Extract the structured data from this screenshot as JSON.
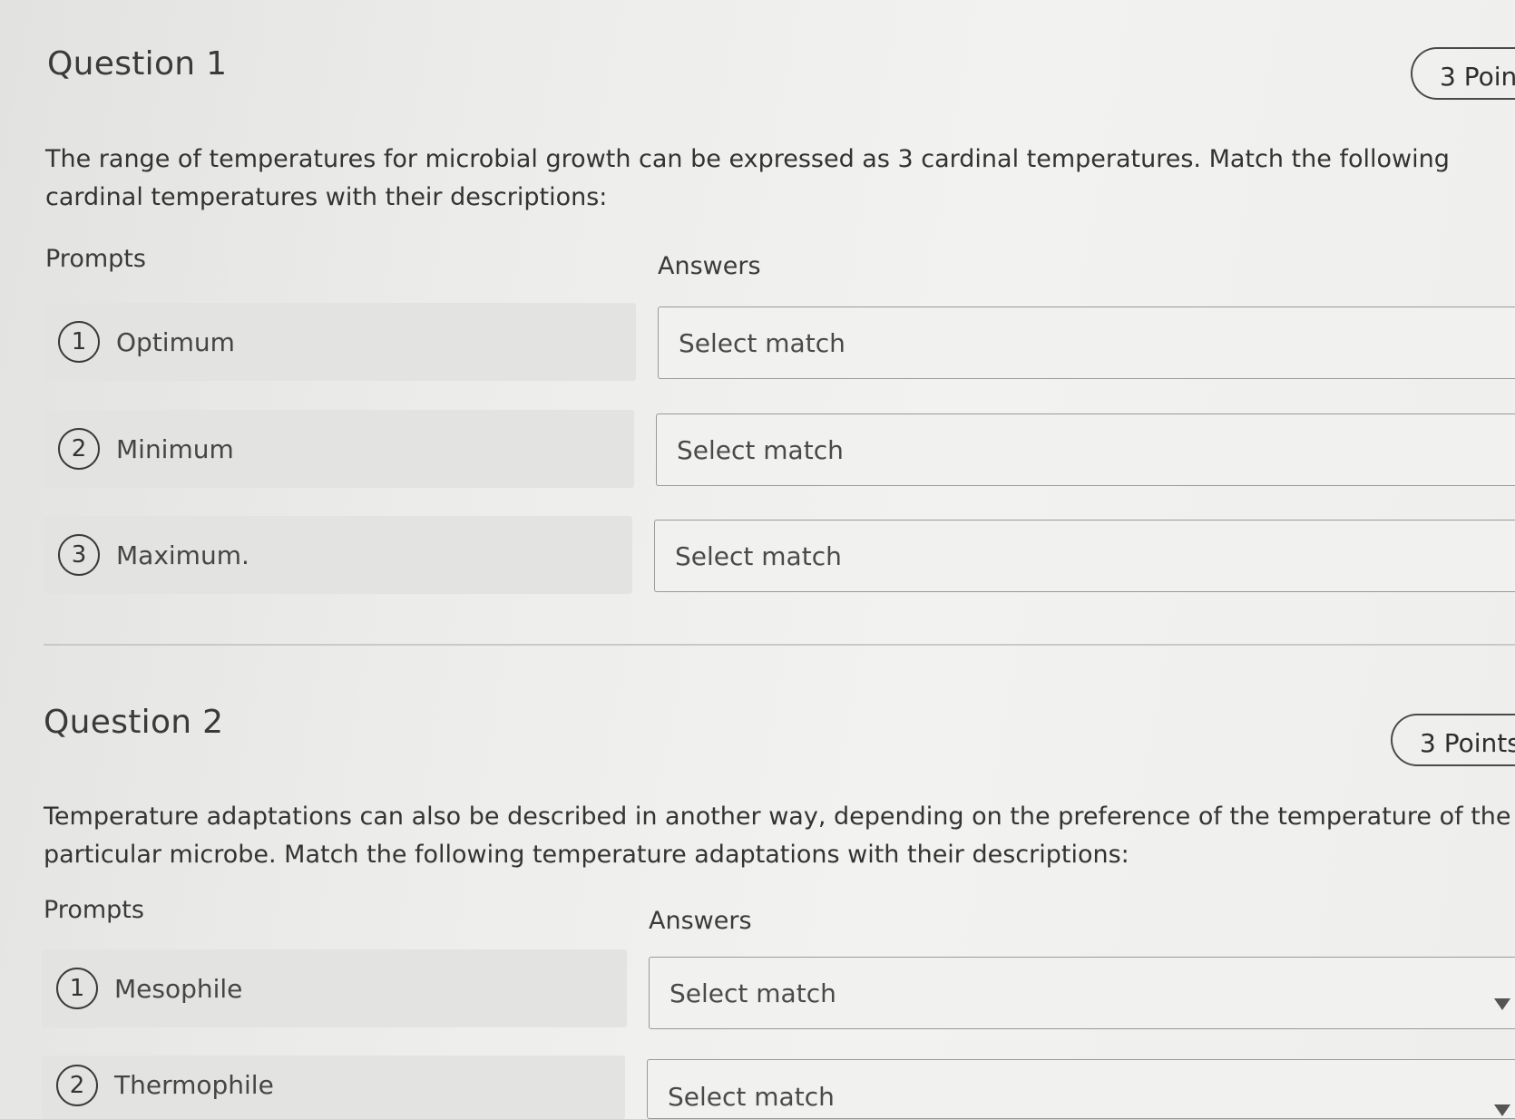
{
  "questions": [
    {
      "title": "Question 1",
      "points": "3 Poin",
      "text": "The range of temperatures for microbial growth can be expressed as 3 cardinal temperatures. Match the following cardinal temperatures with their descriptions:",
      "prompts_label": "Prompts",
      "answers_label": "Answers",
      "prompts": [
        {
          "number": "1",
          "label": "Optimum",
          "answer": "Select match"
        },
        {
          "number": "2",
          "label": "Minimum",
          "answer": "Select match"
        },
        {
          "number": "3",
          "label": "Maximum.",
          "answer": "Select match"
        }
      ]
    },
    {
      "title": "Question 2",
      "points": "3 Points",
      "text": "Temperature adaptations can also be described in another way, depending on the preference of the temperature of the particular microbe. Match the following temperature adaptations with their descriptions:",
      "prompts_label": "Prompts",
      "answers_label": "Answers",
      "prompts": [
        {
          "number": "1",
          "label": "Mesophile",
          "answer": "Select match"
        },
        {
          "number": "2",
          "label": "Thermophile",
          "answer": "Select match"
        }
      ]
    }
  ],
  "icons": {
    "dropdown": "chevron-down-icon"
  },
  "colors": {
    "page_bg": "#ececea",
    "prompt_bg": "#e3e3e1",
    "border": "#9a9a98",
    "text": "#333333"
  }
}
